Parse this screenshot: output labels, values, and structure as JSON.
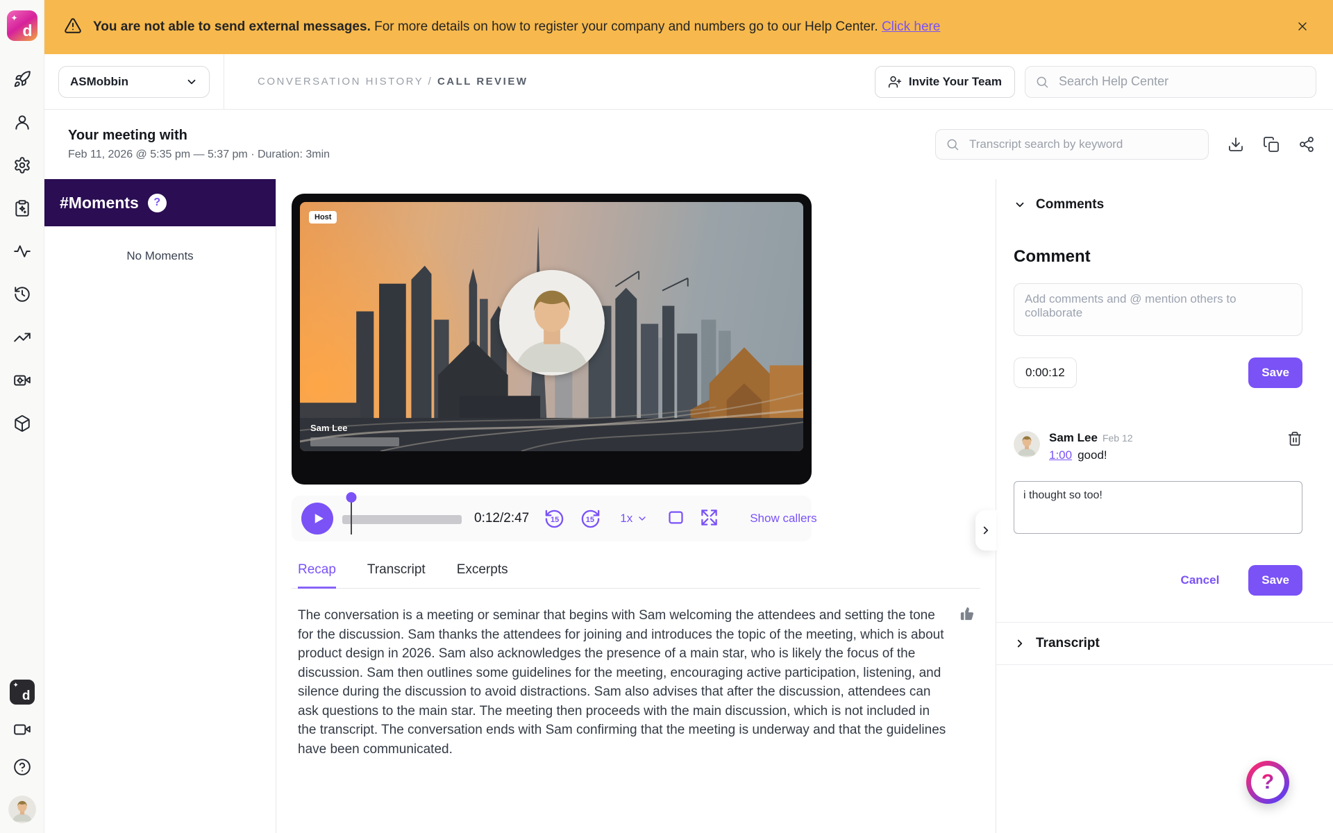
{
  "banner": {
    "bold_text": "You are not able to send external messages.",
    "text": " For more details on how to register your company and numbers go to our Help Center. ",
    "link_text": "Click here"
  },
  "sidebar": {
    "logo_letter": "d",
    "logo_sparkle": "✦",
    "badge_letter": "d",
    "badge_sparkle": "✦",
    "nav_icons": [
      "rocket",
      "person",
      "gear",
      "clipboard-sparkle",
      "activity",
      "history",
      "trending-up",
      "video-settings",
      "cube"
    ],
    "bottom_icons": [
      "dubb-badge",
      "video-camera",
      "help-circle",
      "user-avatar"
    ]
  },
  "header": {
    "workspace_name": "ASMobbin",
    "breadcrumb_parent": "CONVERSATION HISTORY",
    "breadcrumb_divider": " / ",
    "breadcrumb_current": "CALL REVIEW",
    "invite_button": "Invite Your Team",
    "help_search_placeholder": "Search Help Center"
  },
  "meeting": {
    "title": "Your meeting with",
    "subtitle": "Feb 11, 2026 @ 5:35 pm — 5:37 pm · Duration: 3min",
    "search_placeholder": "Transcript search by keyword"
  },
  "moments": {
    "title": "#Moments",
    "help_badge": "?",
    "empty_text": "No Moments"
  },
  "player": {
    "host_badge": "Host",
    "caller_name": "Sam Lee",
    "time_display": "0:12/2:47",
    "progress_pct": 7,
    "skip_back_label": "15",
    "skip_fwd_label": "15",
    "speed": "1x",
    "show_callers": "Show callers"
  },
  "tabs": [
    {
      "label": "Recap",
      "active": true
    },
    {
      "label": "Transcript",
      "active": false
    },
    {
      "label": "Excerpts",
      "active": false
    }
  ],
  "recap": {
    "text": "The conversation is a meeting or seminar that begins with Sam welcoming the attendees and setting the tone for the discussion. Sam thanks the attendees for joining and introduces the topic of the meeting, which is about product design in 2026. Sam also acknowledges the presence of a main star, who is likely the focus of the discussion. Sam then outlines some guidelines for the meeting, encouraging active participation, listening, and silence during the discussion to avoid distractions. Sam also advises that after the discussion, attendees can ask questions to the main star. The meeting then proceeds with the main discussion, which is not included in the transcript. The conversation ends with Sam confirming that the meeting is underway and that the guidelines have been communicated."
  },
  "comments": {
    "section_title": "Comments",
    "form_heading": "Comment",
    "input_placeholder": "Add comments and @ mention others to collaborate",
    "timestamp_chip": "0:00:12",
    "save_button": "Save",
    "comment": {
      "author": "Sam Lee",
      "date": "Feb 12",
      "time_link": "1:00",
      "text": "good!"
    },
    "reply": {
      "value": "i thought so too!",
      "cancel_button": "Cancel",
      "save_button": "Save"
    }
  },
  "transcript_section": {
    "title": "Transcript"
  },
  "help_fab": {
    "glyph": "?"
  },
  "colors": {
    "accent": "#7a52f6",
    "banner_bg": "#f7b94d",
    "moments_header_bg": "#2a0d52"
  }
}
